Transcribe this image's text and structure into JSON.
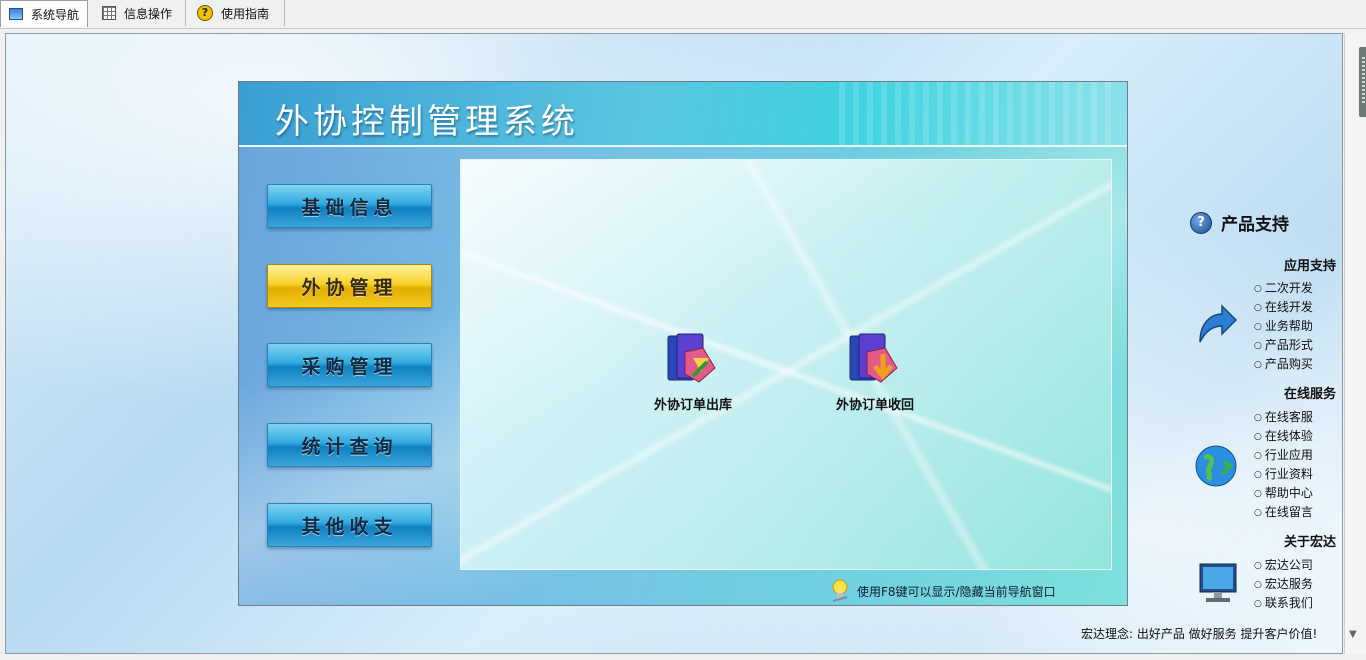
{
  "tabs": [
    {
      "label": "系统导航",
      "icon": "monitor-icon",
      "active": true
    },
    {
      "label": "信息操作",
      "icon": "grid-icon",
      "active": false
    },
    {
      "label": "使用指南",
      "icon": "help-icon",
      "active": false
    }
  ],
  "panel": {
    "title": "外协控制管理系统",
    "nav": [
      "基础信息",
      "外协管理",
      "采购管理",
      "统计查询",
      "其他收支"
    ],
    "active_nav": "外协管理",
    "functions": [
      {
        "label": "外协订单出库",
        "icon": "folder-out-icon"
      },
      {
        "label": "外协订单收回",
        "icon": "folder-in-icon"
      }
    ],
    "tip": "使用F8键可以显示/隐藏当前导航窗口"
  },
  "support": {
    "title": "产品支持",
    "sections": [
      {
        "title": "应用支持",
        "icon": "arrow-icon",
        "items": [
          "二次开发",
          "在线开发",
          "业务帮助",
          "产品形式",
          "产品购买"
        ]
      },
      {
        "title": "在线服务",
        "icon": "globe-icon",
        "items": [
          "在线客服",
          "在线体验",
          "行业应用",
          "行业资料",
          "帮助中心",
          "在线留言"
        ]
      },
      {
        "title": "关于宏达",
        "icon": "monitor-screen-icon",
        "items": [
          "宏达公司",
          "宏达服务",
          "联系我们"
        ]
      }
    ]
  },
  "footer": {
    "slogan": "宏达理念: 出好产品  做好服务  提升客户价值!"
  },
  "colors": {
    "nav_button": "#1f90cf",
    "nav_active": "#f2c81a",
    "header": "#3fc6e0"
  }
}
